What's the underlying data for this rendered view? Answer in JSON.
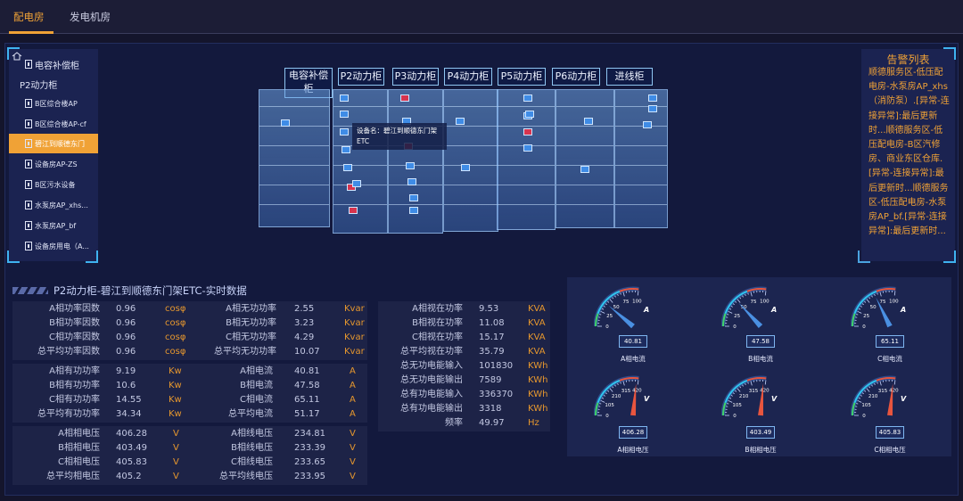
{
  "tabs": [
    {
      "label": "配电房",
      "active": true
    },
    {
      "label": "发电机房",
      "active": false
    }
  ],
  "tree": [
    {
      "label": "电容补偿柜",
      "level": 1
    },
    {
      "label": "P2动力柜",
      "level": 1
    },
    {
      "label": "B区综合楼AP",
      "level": 2
    },
    {
      "label": "B区综合楼AP-cf",
      "level": 2
    },
    {
      "label": "碧江到顺德东门",
      "level": 2,
      "selected": true
    },
    {
      "label": "设备房AP-ZS",
      "level": 2
    },
    {
      "label": "B区污水设备",
      "level": 2
    },
    {
      "label": "水泵房AP_xhs...",
      "level": 2
    },
    {
      "label": "水泵房AP_bf",
      "level": 2
    },
    {
      "label": "设备房用电（A...",
      "level": 2
    }
  ],
  "cabinets": {
    "labels": [
      "电容补偿柜",
      "P2动力柜",
      "P3动力柜",
      "P4动力柜",
      "P5动力柜",
      "P6动力柜",
      "进线柜"
    ],
    "tooltip": "设备名：碧江到顺德东门架ETC"
  },
  "alarm": {
    "title": "告警列表",
    "text": "顺德服务区-低压配电房-水泵房AP_xhs（消防泵）.[异常-连接异常]:最后更新时...顺德服务区-低压配电房-B区汽修房、商业东区仓库.[异常-连接异常]:最后更新时...顺德服务区-低压配电房-水泵房AP_bf.[异常-连接异常]:最后更新时..."
  },
  "section_title": "P2动力柜-碧江到顺德东门架ETC-实时数据",
  "tables": {
    "power_factor": [
      [
        "A相功率因数",
        "0.96",
        "cosφ"
      ],
      [
        "B相功率因数",
        "0.96",
        "cosφ"
      ],
      [
        "C相功率因数",
        "0.96",
        "cosφ"
      ],
      [
        "总平均功率因数",
        "0.96",
        "cosφ"
      ]
    ],
    "reactive": [
      [
        "A相无功功率",
        "2.55",
        "Kvar"
      ],
      [
        "B相无功功率",
        "3.23",
        "Kvar"
      ],
      [
        "C相无功功率",
        "4.29",
        "Kvar"
      ],
      [
        "总平均无功功率",
        "10.07",
        "Kvar"
      ]
    ],
    "active": [
      [
        "A相有功功率",
        "9.19",
        "Kw"
      ],
      [
        "B相有功功率",
        "10.6",
        "Kw"
      ],
      [
        "C相有功功率",
        "14.55",
        "Kw"
      ],
      [
        "总平均有功功率",
        "34.34",
        "Kw"
      ]
    ],
    "current": [
      [
        "A相电流",
        "40.81",
        "A"
      ],
      [
        "B相电流",
        "47.58",
        "A"
      ],
      [
        "C相电流",
        "65.11",
        "A"
      ],
      [
        "总平均电流",
        "51.17",
        "A"
      ]
    ],
    "phase_voltage": [
      [
        "A相相电压",
        "406.28",
        "V"
      ],
      [
        "B相相电压",
        "403.49",
        "V"
      ],
      [
        "C相相电压",
        "405.83",
        "V"
      ],
      [
        "总平均相电压",
        "405.2",
        "V"
      ]
    ],
    "line_voltage": [
      [
        "A相线电压",
        "234.81",
        "V"
      ],
      [
        "B相线电压",
        "233.39",
        "V"
      ],
      [
        "C相线电压",
        "233.65",
        "V"
      ],
      [
        "总平均线电压",
        "233.95",
        "V"
      ]
    ],
    "apparent": [
      [
        "A相视在功率",
        "9.53",
        "KVA"
      ],
      [
        "B相视在功率",
        "11.08",
        "KVA"
      ],
      [
        "C相视在功率",
        "15.17",
        "KVA"
      ],
      [
        "总平均视在功率",
        "35.79",
        "KVA"
      ],
      [
        "总无功电能输入",
        "101830",
        "KWh"
      ],
      [
        "总无功电能输出",
        "7589",
        "KWh"
      ],
      [
        "总有功电能输入",
        "336370",
        "KWh"
      ],
      [
        "总有功电能输出",
        "3318",
        "KWh"
      ],
      [
        "频率",
        "49.97",
        "Hz"
      ]
    ]
  },
  "gauges": {
    "current": [
      {
        "caption": "A相电流",
        "value": "40.81",
        "reading": 40.81,
        "unit": "A",
        "ticks": [
          "0",
          "25",
          "50",
          "75",
          "100"
        ],
        "max": 100
      },
      {
        "caption": "B相电流",
        "value": "47.58",
        "reading": 47.58,
        "unit": "A",
        "ticks": [
          "0",
          "25",
          "50",
          "75",
          "100"
        ],
        "max": 100
      },
      {
        "caption": "C相电流",
        "value": "65.11",
        "reading": 65.11,
        "unit": "A",
        "ticks": [
          "0",
          "25",
          "50",
          "75",
          "100"
        ],
        "max": 100
      }
    ],
    "voltage": [
      {
        "caption": "A相相电压",
        "value": "406.28",
        "reading": 406.28,
        "unit": "V",
        "ticks": [
          "0",
          "105",
          "210",
          "315",
          "420"
        ],
        "max": 420
      },
      {
        "caption": "B相相电压",
        "value": "403.49",
        "reading": 403.49,
        "unit": "V",
        "ticks": [
          "0",
          "105",
          "210",
          "315",
          "420"
        ],
        "max": 420
      },
      {
        "caption": "C相相电压",
        "value": "405.83",
        "reading": 405.83,
        "unit": "V",
        "ticks": [
          "0",
          "105",
          "210",
          "315",
          "420"
        ],
        "max": 420
      }
    ]
  },
  "colors": {
    "accent": "#f0a236",
    "needle_current": "#4a90e2",
    "needle_voltage": "#e8553e"
  }
}
